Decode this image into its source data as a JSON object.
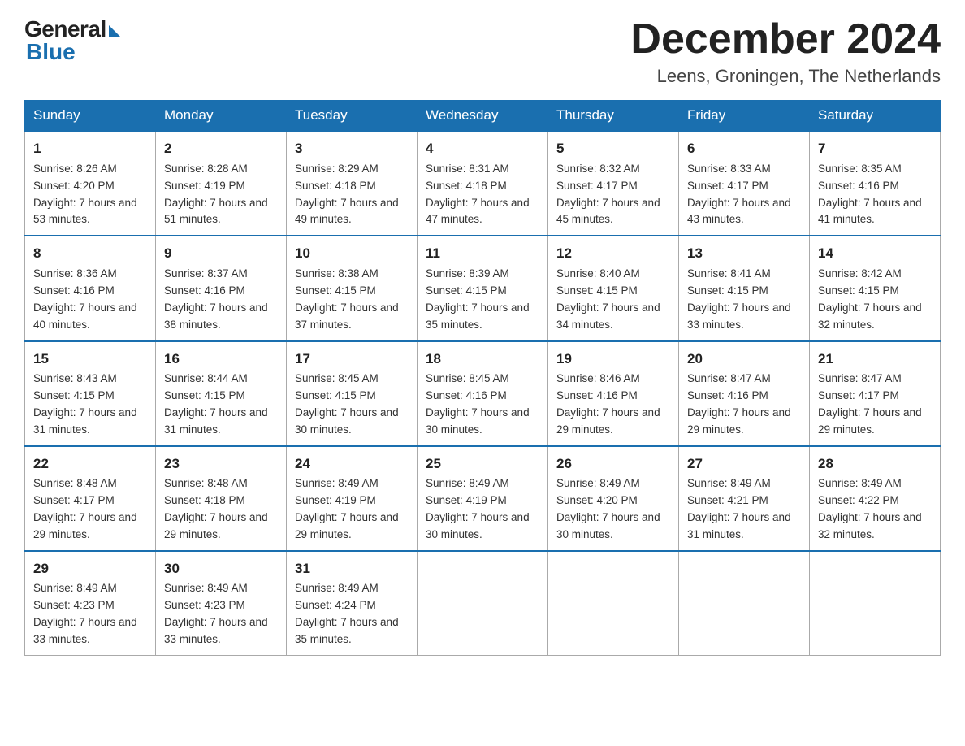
{
  "header": {
    "logo_general": "General",
    "logo_blue": "Blue",
    "month_title": "December 2024",
    "location": "Leens, Groningen, The Netherlands"
  },
  "days_of_week": [
    "Sunday",
    "Monday",
    "Tuesday",
    "Wednesday",
    "Thursday",
    "Friday",
    "Saturday"
  ],
  "weeks": [
    [
      {
        "day": "1",
        "sunrise": "8:26 AM",
        "sunset": "4:20 PM",
        "daylight": "7 hours and 53 minutes."
      },
      {
        "day": "2",
        "sunrise": "8:28 AM",
        "sunset": "4:19 PM",
        "daylight": "7 hours and 51 minutes."
      },
      {
        "day": "3",
        "sunrise": "8:29 AM",
        "sunset": "4:18 PM",
        "daylight": "7 hours and 49 minutes."
      },
      {
        "day": "4",
        "sunrise": "8:31 AM",
        "sunset": "4:18 PM",
        "daylight": "7 hours and 47 minutes."
      },
      {
        "day": "5",
        "sunrise": "8:32 AM",
        "sunset": "4:17 PM",
        "daylight": "7 hours and 45 minutes."
      },
      {
        "day": "6",
        "sunrise": "8:33 AM",
        "sunset": "4:17 PM",
        "daylight": "7 hours and 43 minutes."
      },
      {
        "day": "7",
        "sunrise": "8:35 AM",
        "sunset": "4:16 PM",
        "daylight": "7 hours and 41 minutes."
      }
    ],
    [
      {
        "day": "8",
        "sunrise": "8:36 AM",
        "sunset": "4:16 PM",
        "daylight": "7 hours and 40 minutes."
      },
      {
        "day": "9",
        "sunrise": "8:37 AM",
        "sunset": "4:16 PM",
        "daylight": "7 hours and 38 minutes."
      },
      {
        "day": "10",
        "sunrise": "8:38 AM",
        "sunset": "4:15 PM",
        "daylight": "7 hours and 37 minutes."
      },
      {
        "day": "11",
        "sunrise": "8:39 AM",
        "sunset": "4:15 PM",
        "daylight": "7 hours and 35 minutes."
      },
      {
        "day": "12",
        "sunrise": "8:40 AM",
        "sunset": "4:15 PM",
        "daylight": "7 hours and 34 minutes."
      },
      {
        "day": "13",
        "sunrise": "8:41 AM",
        "sunset": "4:15 PM",
        "daylight": "7 hours and 33 minutes."
      },
      {
        "day": "14",
        "sunrise": "8:42 AM",
        "sunset": "4:15 PM",
        "daylight": "7 hours and 32 minutes."
      }
    ],
    [
      {
        "day": "15",
        "sunrise": "8:43 AM",
        "sunset": "4:15 PM",
        "daylight": "7 hours and 31 minutes."
      },
      {
        "day": "16",
        "sunrise": "8:44 AM",
        "sunset": "4:15 PM",
        "daylight": "7 hours and 31 minutes."
      },
      {
        "day": "17",
        "sunrise": "8:45 AM",
        "sunset": "4:15 PM",
        "daylight": "7 hours and 30 minutes."
      },
      {
        "day": "18",
        "sunrise": "8:45 AM",
        "sunset": "4:16 PM",
        "daylight": "7 hours and 30 minutes."
      },
      {
        "day": "19",
        "sunrise": "8:46 AM",
        "sunset": "4:16 PM",
        "daylight": "7 hours and 29 minutes."
      },
      {
        "day": "20",
        "sunrise": "8:47 AM",
        "sunset": "4:16 PM",
        "daylight": "7 hours and 29 minutes."
      },
      {
        "day": "21",
        "sunrise": "8:47 AM",
        "sunset": "4:17 PM",
        "daylight": "7 hours and 29 minutes."
      }
    ],
    [
      {
        "day": "22",
        "sunrise": "8:48 AM",
        "sunset": "4:17 PM",
        "daylight": "7 hours and 29 minutes."
      },
      {
        "day": "23",
        "sunrise": "8:48 AM",
        "sunset": "4:18 PM",
        "daylight": "7 hours and 29 minutes."
      },
      {
        "day": "24",
        "sunrise": "8:49 AM",
        "sunset": "4:19 PM",
        "daylight": "7 hours and 29 minutes."
      },
      {
        "day": "25",
        "sunrise": "8:49 AM",
        "sunset": "4:19 PM",
        "daylight": "7 hours and 30 minutes."
      },
      {
        "day": "26",
        "sunrise": "8:49 AM",
        "sunset": "4:20 PM",
        "daylight": "7 hours and 30 minutes."
      },
      {
        "day": "27",
        "sunrise": "8:49 AM",
        "sunset": "4:21 PM",
        "daylight": "7 hours and 31 minutes."
      },
      {
        "day": "28",
        "sunrise": "8:49 AM",
        "sunset": "4:22 PM",
        "daylight": "7 hours and 32 minutes."
      }
    ],
    [
      {
        "day": "29",
        "sunrise": "8:49 AM",
        "sunset": "4:23 PM",
        "daylight": "7 hours and 33 minutes."
      },
      {
        "day": "30",
        "sunrise": "8:49 AM",
        "sunset": "4:23 PM",
        "daylight": "7 hours and 33 minutes."
      },
      {
        "day": "31",
        "sunrise": "8:49 AM",
        "sunset": "4:24 PM",
        "daylight": "7 hours and 35 minutes."
      },
      null,
      null,
      null,
      null
    ]
  ]
}
